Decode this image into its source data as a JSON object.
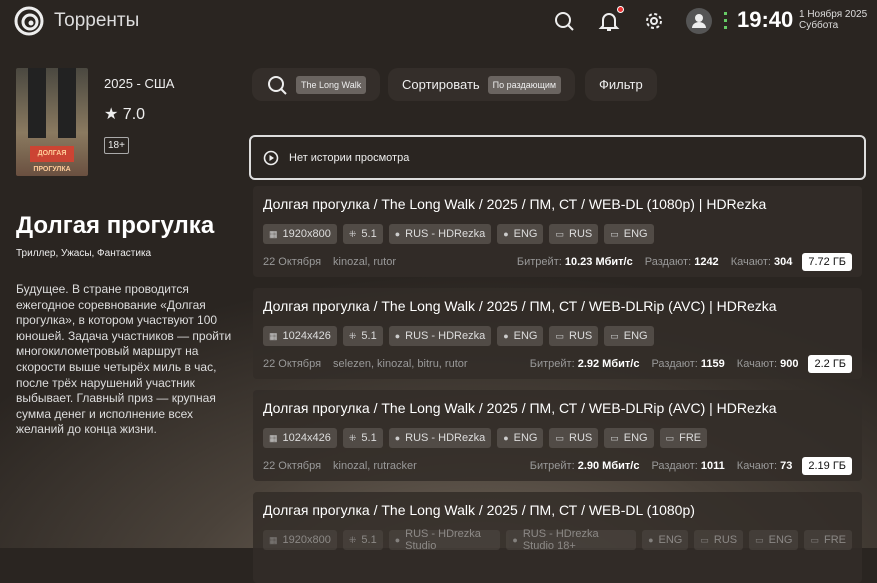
{
  "header": {
    "app_title": "Торренты",
    "time": "19:40",
    "date": "1 Ноября 2025",
    "weekday": "Суббота"
  },
  "movie": {
    "year_country": "2025 - США",
    "rating": "7.0",
    "age": "18+",
    "title": "Долгая прогулка",
    "genres": "Триллер, Ужасы, Фантастика",
    "poster_text": "ДОЛГАЯ ПРОГУЛКА",
    "description": "Будущее. В стране проводится ежегодное соревнование «Долгая прогулка», в котором участвуют 100 юношей. Задача участников — пройти многокилометровый маршрут на скорости выше четырёх миль в час, после трёх нарушений участник выбывает. Главный приз — крупная сумма денег и исполнение всех желаний до конца жизни."
  },
  "toolbar": {
    "search_value": "The Long Walk",
    "sort_label": "Сортировать",
    "sort_value": "По раздающим",
    "filter_label": "Фильтр"
  },
  "history": {
    "label": "Нет истории просмотра"
  },
  "labels": {
    "bitrate": "Битрейт:",
    "seeders": "Раздают:",
    "leechers": "Качают:"
  },
  "torrents": [
    {
      "title": "Долгая прогулка / The Long Walk / 2025 / ПМ, СТ / WEB-DL (1080p) | HDRezka",
      "tags": [
        [
          "video",
          "1920x800"
        ],
        [
          "audio",
          "5.1"
        ],
        [
          "voice",
          "RUS - HDRezka"
        ],
        [
          "voice",
          "ENG"
        ],
        [
          "sub",
          "RUS"
        ],
        [
          "sub",
          "ENG"
        ]
      ],
      "date": "22 Октября",
      "trackers": "kinozal, rutor",
      "bitrate": "10.23 Мбит/с",
      "seeders": "1242",
      "leechers": "304",
      "size": "7.72 ГБ"
    },
    {
      "title": "Долгая прогулка / The Long Walk / 2025 / ПМ, СТ / WEB-DLRip (AVC) | HDRezka",
      "tags": [
        [
          "video",
          "1024x426"
        ],
        [
          "audio",
          "5.1"
        ],
        [
          "voice",
          "RUS - HDRezka"
        ],
        [
          "voice",
          "ENG"
        ],
        [
          "sub",
          "RUS"
        ],
        [
          "sub",
          "ENG"
        ]
      ],
      "date": "22 Октября",
      "trackers": "selezen, kinozal, bitru, rutor",
      "bitrate": "2.92 Мбит/с",
      "seeders": "1159",
      "leechers": "900",
      "size": "2.2 ГБ"
    },
    {
      "title": "Долгая прогулка / The Long Walk / 2025 / ПМ, СТ / WEB-DLRip (AVC) | HDRezka",
      "tags": [
        [
          "video",
          "1024x426"
        ],
        [
          "audio",
          "5.1"
        ],
        [
          "voice",
          "RUS - HDRezka"
        ],
        [
          "voice",
          "ENG"
        ],
        [
          "sub",
          "RUS"
        ],
        [
          "sub",
          "ENG"
        ],
        [
          "sub",
          "FRE"
        ]
      ],
      "date": "22 Октября",
      "trackers": "kinozal, rutracker",
      "bitrate": "2.90 Мбит/с",
      "seeders": "1011",
      "leechers": "73",
      "size": "2.19 ГБ"
    },
    {
      "title": "Долгая прогулка / The Long Walk / 2025 / ПМ, СТ / WEB-DL (1080p)",
      "tags": [
        [
          "video",
          "1920x800"
        ],
        [
          "audio",
          "5.1"
        ],
        [
          "voice",
          "RUS - HDrezka Studio"
        ],
        [
          "voice",
          "RUS - HDrezka Studio 18+"
        ],
        [
          "voice",
          "ENG"
        ],
        [
          "sub",
          "RUS"
        ],
        [
          "sub",
          "ENG"
        ],
        [
          "sub",
          "FRE"
        ]
      ]
    }
  ]
}
